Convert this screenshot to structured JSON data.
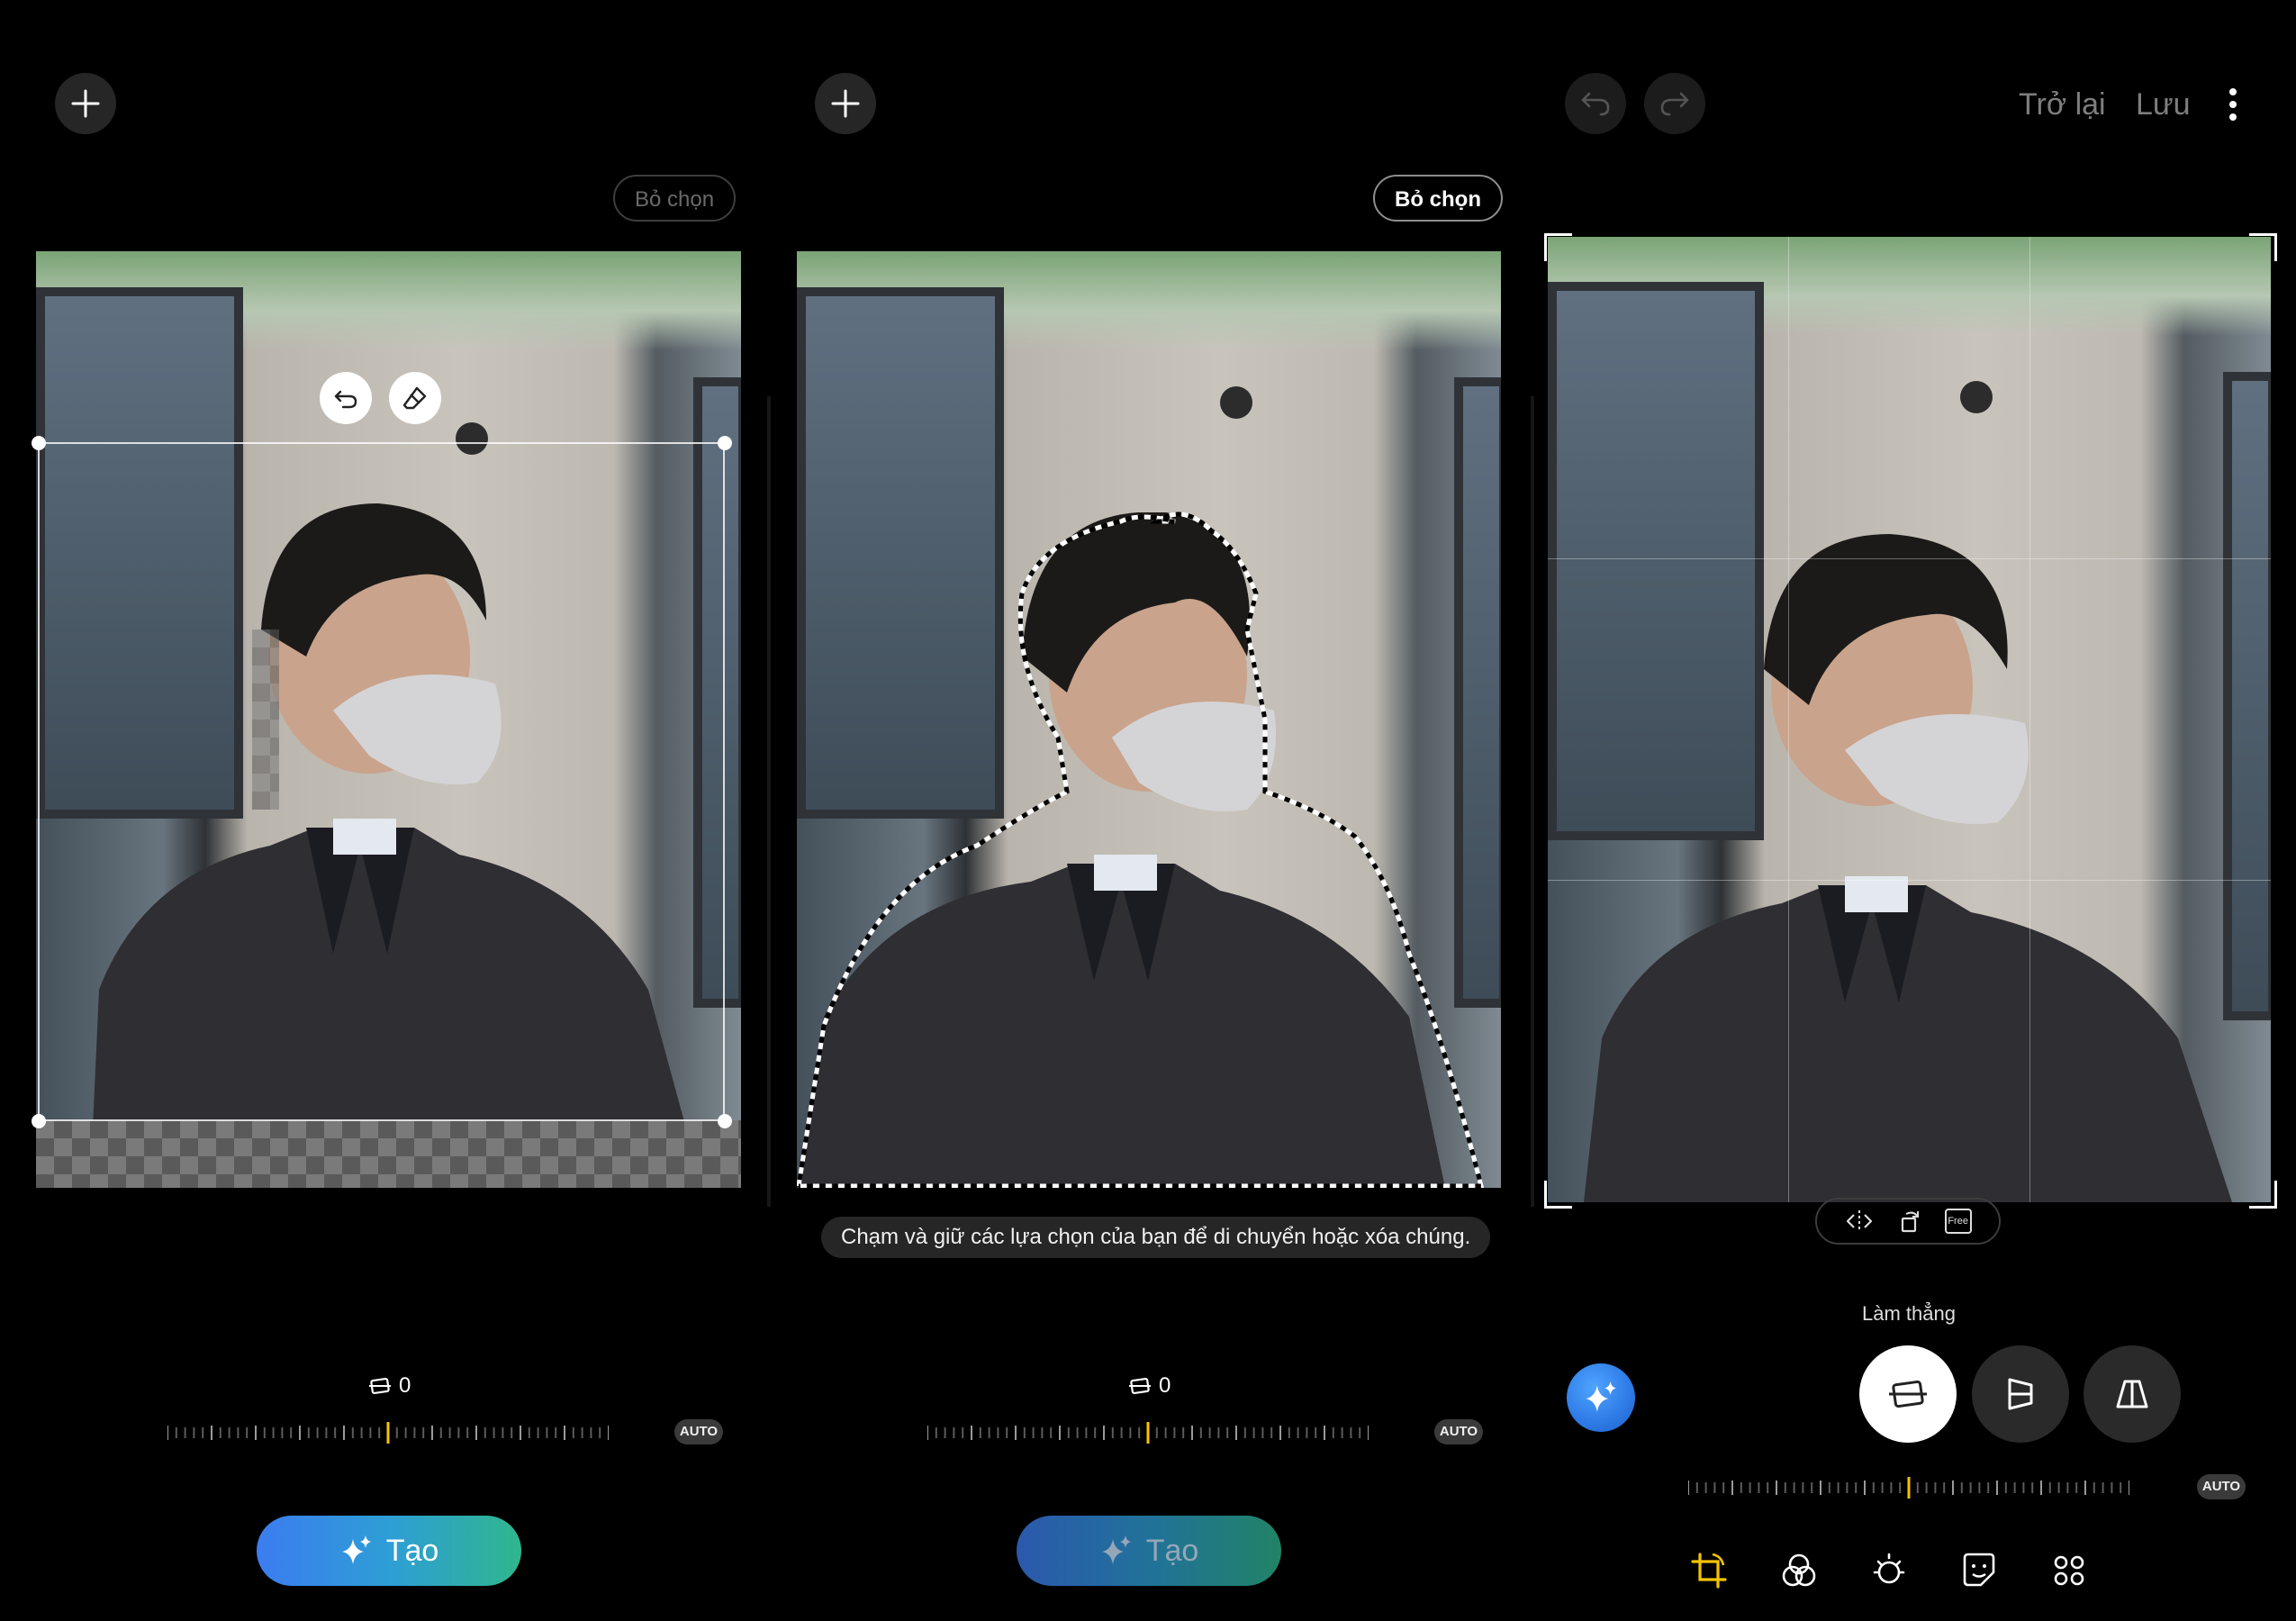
{
  "panel1": {
    "deselect_label": "Bỏ chọn",
    "angle_value": "0",
    "auto_label": "AUTO",
    "create_label": "Tạo"
  },
  "panel2": {
    "deselect_label": "Bỏ chọn",
    "hint": "Chạm và giữ các lựa chọn của bạn để di chuyển hoặc xóa chúng.",
    "angle_value": "0",
    "auto_label": "AUTO",
    "create_label": "Tạo"
  },
  "panel3": {
    "back_label": "Trở lại",
    "save_label": "Lưu",
    "free_label": "Free",
    "mode_label": "Làm thẳng",
    "auto_label": "AUTO",
    "accent_color": "#f5c400"
  },
  "icons": {
    "add": "plus-icon",
    "undo": "undo-icon",
    "redo": "redo-icon",
    "more": "more-vertical-icon",
    "sparkle": "sparkle-icon",
    "eraser": "eraser-icon",
    "revert": "revert-icon"
  }
}
